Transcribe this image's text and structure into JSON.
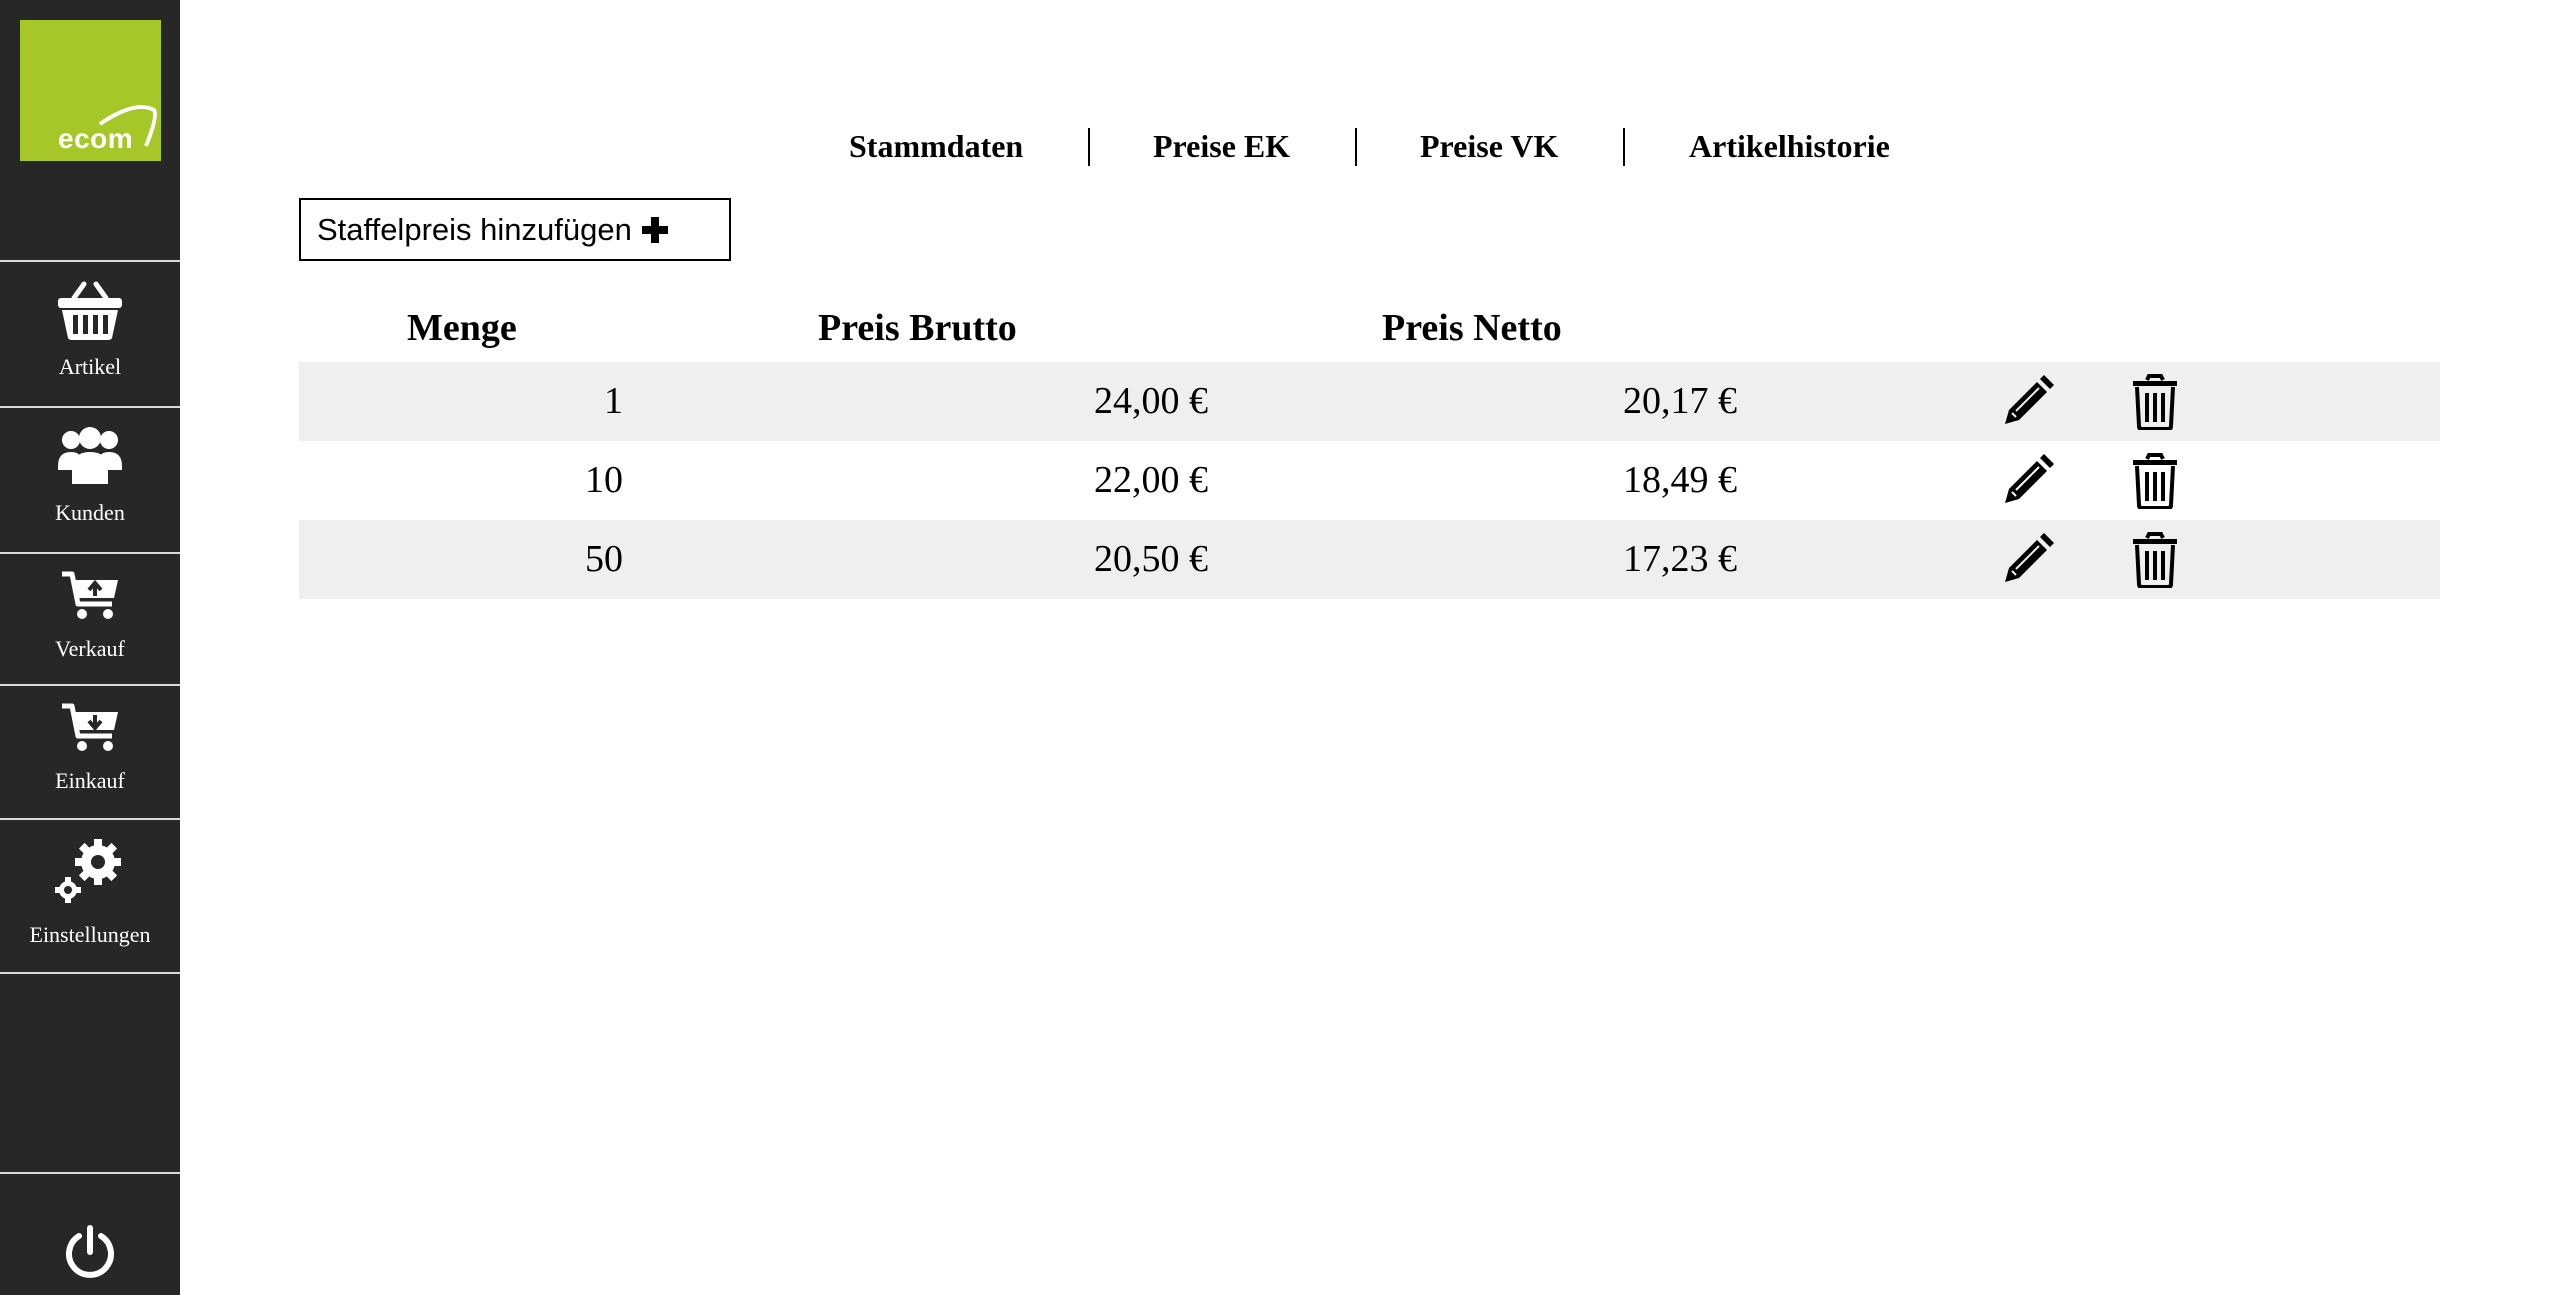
{
  "sidebar": {
    "logo_text": "ecom",
    "items": [
      {
        "label": "Artikel",
        "icon": "basket-icon"
      },
      {
        "label": "Kunden",
        "icon": "users-icon"
      },
      {
        "label": "Verkauf",
        "icon": "cart-upload-icon"
      },
      {
        "label": "Einkauf",
        "icon": "cart-download-icon"
      },
      {
        "label": "Einstellungen",
        "icon": "gears-icon"
      }
    ],
    "power_icon": "power-icon"
  },
  "tabs": [
    {
      "label": "Stammdaten"
    },
    {
      "label": "Preise EK"
    },
    {
      "label": "Preise VK"
    },
    {
      "label": "Artikelhistorie"
    }
  ],
  "add_button": {
    "label": "Staffelpreis hinzufügen",
    "icon": "plus-icon"
  },
  "table": {
    "headers": {
      "menge": "Menge",
      "brutto": "Preis Brutto",
      "netto": "Preis Netto"
    },
    "rows": [
      {
        "menge": "1",
        "brutto": "24,00 €",
        "netto": "20,17 €"
      },
      {
        "menge": "10",
        "brutto": "22,00 €",
        "netto": "18,49 €"
      },
      {
        "menge": "50",
        "brutto": "20,50 €",
        "netto": "17,23 €"
      }
    ],
    "row_actions": [
      "pencil-icon",
      "trash-icon"
    ]
  },
  "colors": {
    "sidebar_bg": "#272727",
    "logo_bg": "#a5c828",
    "row_shade": "#efefef"
  }
}
